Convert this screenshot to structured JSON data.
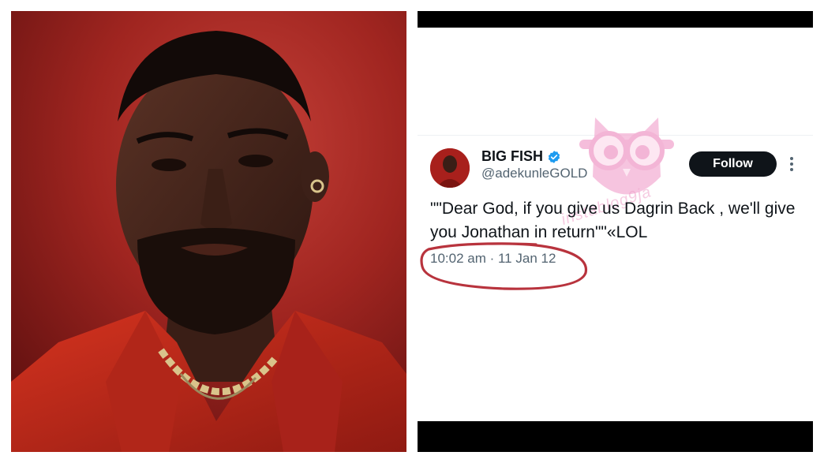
{
  "tweet": {
    "display_name": "BIG FISH",
    "handle": "@adekunleGOLD",
    "follow_label": "Follow",
    "text": "\"\"Dear God, if you give us Dagrin Back , we'll give you Jonathan in return\"\"«LOL",
    "timestamp": "10:02 am · 11 Jan 12"
  },
  "watermark": {
    "text": "instablog9ja"
  },
  "colors": {
    "photo_background": "#9f2320",
    "shirt": "#c22a1e",
    "follow_button": "#0f1419",
    "verified_badge": "#1d9bf0",
    "annotation_circle": "#b8333d",
    "watermark_pink": "#f2a9cf"
  },
  "icons": {
    "verified": "verified-badge-icon",
    "more": "more-options-icon",
    "watermark_logo": "owl-logo-icon"
  }
}
